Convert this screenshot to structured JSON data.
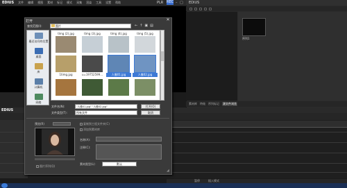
{
  "app": {
    "logo": "EDIUS",
    "menu": [
      "文件",
      "编辑",
      "视图",
      "素材",
      "标记",
      "模式",
      "采集",
      "渲染",
      "工具",
      "设置",
      "帮助"
    ],
    "plr": "PLR",
    "rec": "REC",
    "win_controls": "– □ ✕"
  },
  "bin": {
    "title": "EDIUS",
    "clip_label": "序列1",
    "tabs": [
      "素材库",
      "特效",
      "序列标记",
      "源文件浏览"
    ]
  },
  "timeline": {
    "title": "EDIUS",
    "status": [
      "暂停",
      "插入模式"
    ]
  },
  "dialog": {
    "title": "打开",
    "lookin_label": "查找范围(I):",
    "lookin_value": "图片",
    "places": [
      "最近访问的位置",
      "桌面",
      "库",
      "计算机",
      "网络"
    ],
    "files": [
      {
        "name": "tlmg (2).jpg",
        "color": "#9a8a72",
        "selected": false
      },
      {
        "name": "tlmg (3).jpg",
        "color": "#c6cfd6",
        "selected": false
      },
      {
        "name": "tlmg (4).jpg",
        "color": "#b8c2c8",
        "selected": false
      },
      {
        "name": "tlmg (5).jpg",
        "color": "#d2d7db",
        "selected": false
      },
      {
        "name": "1timg.jpg",
        "color": "#b79f6a",
        "selected": false
      },
      {
        "name": "u=19752599...",
        "color": "#4a4a4a",
        "selected": false
      },
      {
        "name": "人像01.jpg",
        "color": "#5f86b5",
        "selected": true
      },
      {
        "name": "人像02.jpg",
        "color": "#6f94c2",
        "selected": true
      },
      {
        "name": "",
        "color": "#a5753e",
        "selected": false
      },
      {
        "name": "",
        "color": "#3f5a35",
        "selected": false
      },
      {
        "name": "",
        "color": "#5c7a48",
        "selected": false
      },
      {
        "name": "",
        "color": "#7c8f66",
        "selected": false
      }
    ],
    "filename_label": "文件名(N):",
    "filename_value": "\"人像01.jpg\" \"人像02.jpg\"",
    "filetype_label": "文件类型(T):",
    "filetype_value": "所有文件",
    "open_label": "打开(O)",
    "cancel_label": "取消",
    "preview_label": "预览(R)",
    "checkbox_copy": "复制到工程文件夹(C)",
    "checkbox_proxy": "添加到素材库",
    "name_label": "名称(A):",
    "note_label": "注释(C):",
    "mode_label": "素材类型(L):",
    "mode_value": "默认",
    "sequence_label": "图片序列(Q)"
  },
  "colors": {
    "accent": "#3d7ad6",
    "dialog_bg": "#3a3a3a",
    "rec": "#3b6fd1"
  }
}
